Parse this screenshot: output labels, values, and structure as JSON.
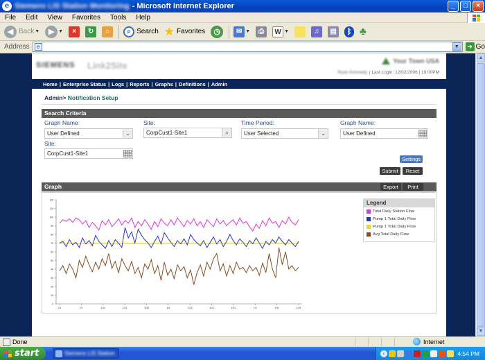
{
  "window": {
    "title_blurred": "Siemens LIS Station Monitoring",
    "title_app": "- Microsoft Internet Explorer",
    "buttons": [
      "_",
      "□",
      "×"
    ]
  },
  "menu": [
    "File",
    "Edit",
    "View",
    "Favorites",
    "Tools",
    "Help"
  ],
  "toolbar": {
    "back": "Back",
    "search": "Search",
    "favorites": "Favorites"
  },
  "address": {
    "label": "Address",
    "value": "",
    "go": "Go"
  },
  "app": {
    "logo": "SIEMENS",
    "product": "Link2Site",
    "org_name": "Your Town USA",
    "user_blurred": "Ryan Kennedy",
    "last_login": "| Last Login: 12/02/2006 | 10:00PM",
    "nav": [
      "Home",
      "Enterprise Status",
      "Logs",
      "Reports",
      "Graphs",
      "Definitions",
      "Admin"
    ],
    "breadcrumb": {
      "root": "Admin>",
      "current": "Notification Setup"
    }
  },
  "criteria": {
    "header": "Search Criteria",
    "fields": [
      {
        "label": "Graph Name:",
        "value": "User Defined",
        "control": "dropdown"
      },
      {
        "label": "Site:",
        "value": "CorpCust1-Site1",
        "control": "search"
      },
      {
        "label": "Time Period:",
        "value": "User Selected",
        "control": "dropdown"
      },
      {
        "label": "Graph Name:",
        "value": "User Defined",
        "control": "calendar"
      },
      {
        "label": "Site:",
        "value": "CorpCust1-Site1",
        "control": "calendar"
      }
    ],
    "settings": "Settings",
    "submit": "Submit",
    "reset": "Reset"
  },
  "graph": {
    "header": "Graph",
    "export": "Export",
    "print": "Print",
    "legend_title": "Legend"
  },
  "chart_data": {
    "type": "line",
    "title": "",
    "xlabel": "",
    "ylabel": "",
    "ylim": [
      0,
      120
    ],
    "yticks": [
      0,
      10,
      20,
      30,
      40,
      50,
      60,
      70,
      80,
      90,
      100,
      110,
      120
    ],
    "xticks": [
      "1/1",
      "1/7",
      "1/14",
      "1/21",
      "1/28",
      "1/3",
      "1/13",
      "1/14",
      "1/21",
      "1/2",
      "1/11",
      "1/15"
    ],
    "grid": false,
    "legend": "right",
    "series": [
      {
        "name": "Total Daily Station Flow",
        "color": "#d838d8",
        "values": [
          93,
          97,
          95,
          98,
          94,
          99,
          97,
          92,
          96,
          88,
          94,
          90,
          85,
          96,
          91,
          97,
          89,
          93,
          98,
          91,
          96,
          93,
          99,
          88,
          95,
          90,
          97,
          92,
          86,
          95,
          89,
          98,
          93,
          90,
          97,
          91,
          99,
          94,
          89,
          96,
          92,
          98,
          90,
          95,
          88,
          97,
          93,
          89,
          98,
          92,
          96,
          90,
          94,
          97,
          91,
          99,
          93,
          95,
          89,
          84,
          92,
          87,
          96,
          90,
          99,
          93,
          95,
          88,
          96,
          92,
          100,
          94,
          91,
          97
        ]
      },
      {
        "name": "Pump 1 Total Daily Flow",
        "color": "#2838b8",
        "values": [
          70,
          72,
          66,
          74,
          68,
          71,
          65,
          76,
          69,
          73,
          67,
          79,
          72,
          68,
          64,
          73,
          66,
          74,
          70,
          65,
          88,
          76,
          83,
          70,
          86,
          79,
          74,
          70,
          65,
          72,
          78,
          69,
          82,
          76,
          71,
          66,
          73,
          69,
          75,
          68,
          80,
          74,
          70,
          67,
          73,
          65,
          71,
          77,
          69,
          74,
          66,
          72,
          80,
          73,
          68,
          75,
          71,
          66,
          73,
          69,
          76,
          70,
          64,
          72,
          68,
          74,
          70,
          77,
          72,
          68,
          74,
          70,
          66,
          72
        ]
      },
      {
        "name": "Pump 1 Total Daily Flow",
        "color": "#e8d820",
        "values": [
          70,
          70,
          70,
          70,
          70,
          70,
          70,
          70,
          70,
          70,
          70,
          70,
          70,
          70,
          70,
          70,
          70,
          70,
          70,
          70,
          70,
          70,
          70,
          70,
          70,
          70,
          70,
          70,
          70,
          70,
          70,
          70,
          70,
          70,
          70,
          70,
          70,
          70,
          70,
          70,
          70,
          70,
          70,
          70,
          70,
          70,
          70,
          70,
          70,
          70,
          70,
          70,
          70,
          70,
          70,
          70,
          70,
          70,
          70,
          70,
          70,
          70,
          70,
          70,
          70,
          70,
          70,
          70,
          70,
          70,
          70,
          70,
          70,
          70
        ]
      },
      {
        "name": "Avg Total Daily Flow",
        "color": "#8a4a20",
        "values": [
          38,
          44,
          35,
          46,
          40,
          30,
          50,
          42,
          55,
          45,
          37,
          48,
          40,
          52,
          44,
          58,
          41,
          49,
          36,
          52,
          44,
          38,
          49,
          35,
          42,
          30,
          46,
          40,
          51,
          35,
          44,
          27,
          48,
          33,
          40,
          29,
          45,
          38,
          43,
          30,
          39,
          22,
          36,
          45,
          32,
          48,
          40,
          52,
          58,
          38,
          46,
          32,
          44,
          35,
          48,
          40,
          42,
          36,
          44,
          38,
          42,
          33,
          47,
          36,
          58,
          40,
          30,
          65,
          45,
          60,
          40,
          44,
          38,
          42
        ]
      }
    ]
  },
  "status": {
    "text": "Done",
    "zone": "Internet"
  },
  "taskbar": {
    "start": "start",
    "task_blurred": "Siemens LIS Station",
    "clock": "4:54 PM"
  }
}
